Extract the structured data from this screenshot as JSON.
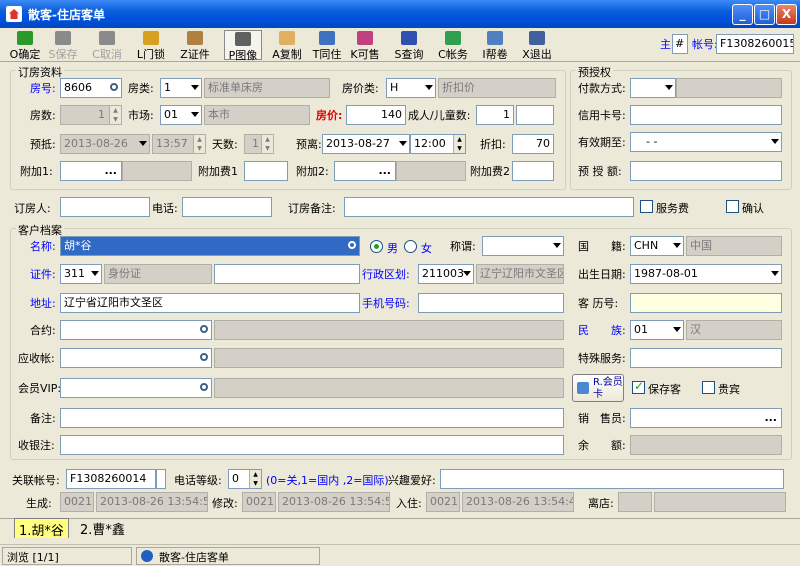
{
  "window": {
    "title": "散客-住店客单",
    "min": "_",
    "max": "□",
    "close": "X"
  },
  "toolbar": [
    {
      "name": "confirm",
      "label": "O确定",
      "color": "#2a9a2a",
      "disabled": false
    },
    {
      "name": "save",
      "label": "S保存",
      "color": "#8a8a8a",
      "disabled": true
    },
    {
      "name": "cancel",
      "label": "C取消",
      "color": "#8a8a8a",
      "disabled": true
    },
    {
      "name": "door-lock",
      "label": "L门锁",
      "color": "#d8a020",
      "disabled": false
    },
    {
      "name": "id-card",
      "label": "Z证件",
      "color": "#b08040",
      "disabled": false
    },
    {
      "name": "image",
      "label": "P图像",
      "color": "#606060",
      "disabled": false
    },
    {
      "name": "copy",
      "label": "A复制",
      "color": "#e0b060",
      "disabled": false
    },
    {
      "name": "same-live",
      "label": "T同住",
      "color": "#4070c0",
      "disabled": false
    },
    {
      "name": "sell",
      "label": "K可售",
      "color": "#c04080",
      "disabled": false
    },
    {
      "name": "query",
      "label": "S查询",
      "color": "#3050b0",
      "disabled": false
    },
    {
      "name": "account",
      "label": "C帐务",
      "color": "#30a050",
      "disabled": false
    },
    {
      "name": "archive",
      "label": "I帮卷",
      "color": "#5080c0",
      "disabled": false
    },
    {
      "name": "exit",
      "label": "X退出",
      "color": "#4060a0",
      "disabled": false
    }
  ],
  "master": {
    "label": "主",
    "value": "#",
    "account_label": "帐号:",
    "account": "F1308260015"
  },
  "booking": {
    "group_label": "订房资料",
    "room_no_label": "房号:",
    "room_no": "8606",
    "room_type_label": "房类:",
    "room_type": "1",
    "room_type_name": "标准单床房",
    "price_type_label": "房价类:",
    "price_type": "H",
    "price_type_name": "折扣价",
    "room_count_label": "房数:",
    "room_count": "1",
    "market_label": "市场:",
    "market": "01",
    "market_name": "本市",
    "price_label": "房价:",
    "price": "140",
    "adults_label": "成人/儿童数:",
    "adults": "1",
    "children": "",
    "arrive_label": "预抵:",
    "arrive_date": "2013-08-26",
    "arrive_time": "13:57",
    "days_label": "天数:",
    "days": "1",
    "depart_label": "预离:",
    "depart_date": "2013-08-27",
    "depart_time": "12:00",
    "discount_label": "折扣:",
    "discount": "70",
    "extra1_label": "附加1:",
    "extra1": "",
    "extra1_fee_label": "附加费1",
    "extra2_label": "附加2:",
    "extra2": "",
    "extra2_fee_label": "附加费2"
  },
  "preauth": {
    "group_label": "预授权",
    "pay_label": "付款方式:",
    "card_label": "信用卡号:",
    "valid_label": "有效期至:",
    "valid_value": "- -",
    "amount_label": "预 授 额:"
  },
  "booker": {
    "name_label": "订房人:",
    "phone_label": "电话:",
    "remark_label": "订房备注:",
    "service_fee_label": "服务费",
    "confirm_label": "确认"
  },
  "customer": {
    "group_label": "客户档案",
    "name_label": "名称:",
    "name": "胡*谷",
    "male_label": "男",
    "female_label": "女",
    "title_label": "称谓:",
    "nation_label": "国　　籍:",
    "nation_code": "CHN",
    "nation_name": "中国",
    "id_label": "证件:",
    "id_type": "311",
    "id_type_name": "身份证",
    "id_no": "",
    "district_label": "行政区划:",
    "district_code": "211003",
    "district_name": "辽宁辽阳市文圣区",
    "birth_label": "出生日期:",
    "birth": "1987-08-01",
    "address_label": "地址:",
    "address": "辽宁省辽阳市文圣区",
    "mobile_label": "手机号码:",
    "history_label": "客 历号:",
    "contract_label": "合约:",
    "ethnic_label": "民　　族:",
    "ethnic_code": "01",
    "ethnic_name": "汉",
    "receivable_label": "应收帐:",
    "special_label": "特殊服务:",
    "vip_label": "会员VIP:",
    "member_card_label": "R.会员卡",
    "keep_label": "保存客",
    "vip_guest_label": "贵宾",
    "remark_label": "备注:",
    "sales_label": "销　售员:",
    "cashier_label": "收银注:",
    "balance_label": "余　　额:"
  },
  "footer": {
    "link_acct_label": "关联帐号:",
    "link_acct": "F1308260014",
    "phone_level_label": "电话等级:",
    "phone_level": "0",
    "phone_level_hint": "(0=关,1=国内 ,2=国际)",
    "hobby_label": "兴趣爱好:",
    "created_label": "生成:",
    "created_op": "0021",
    "created_time": "2013-08-26 13:54:56",
    "modified_label": "修改:",
    "modified_op": "0021",
    "modified_time": "2013-08-26 13:54:57",
    "checkin_label": "入住:",
    "checkin_op": "0021",
    "checkin_time": "2013-08-26 13:54:46",
    "shop_label": "离店:"
  },
  "tabs": [
    {
      "label": "1.胡*谷"
    },
    {
      "label": "2.曹*鑫"
    }
  ],
  "status": {
    "browse": "浏览 [1/1]",
    "form": "散客-住店客单"
  }
}
